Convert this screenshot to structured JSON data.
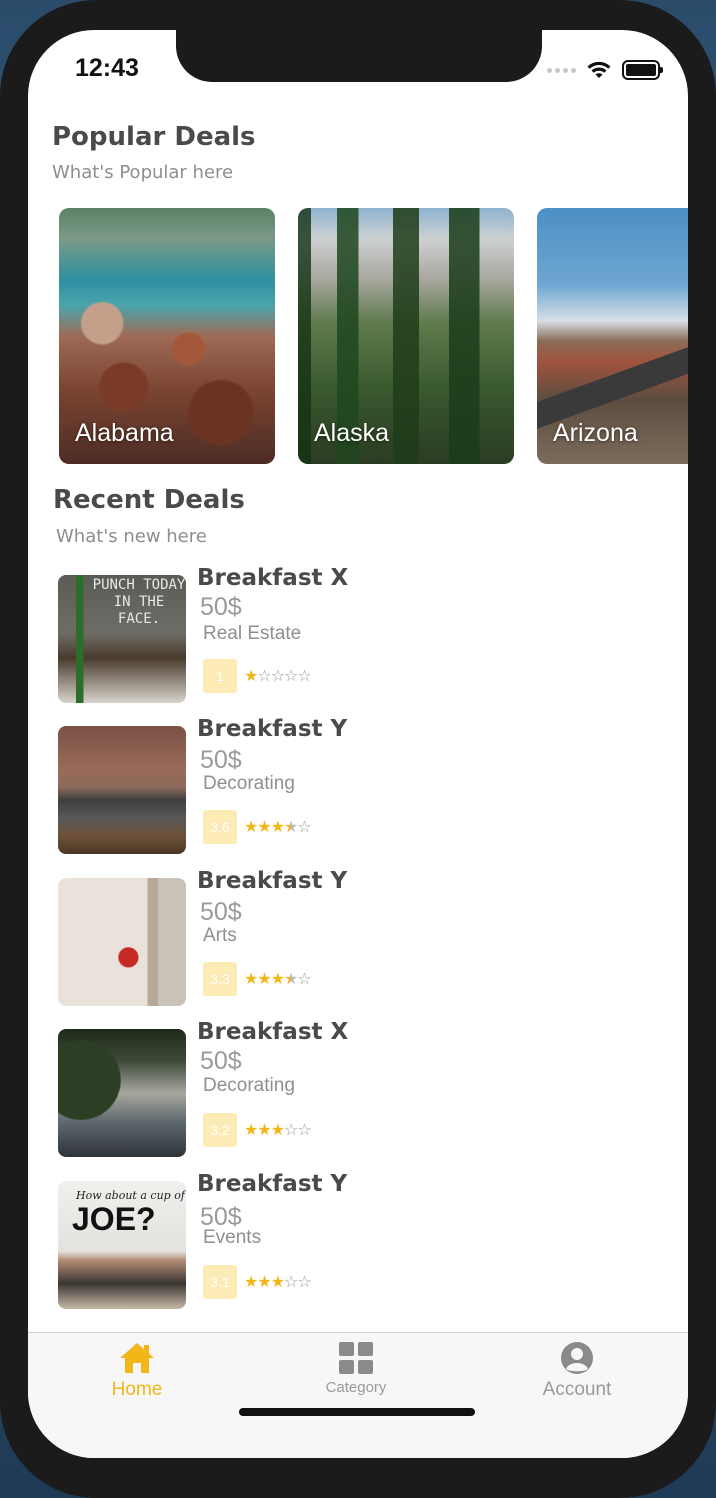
{
  "status_bar": {
    "time": "12:43"
  },
  "popular": {
    "title": "Popular Deals",
    "subtitle": "What's Popular here",
    "cards": [
      {
        "label": "Alabama"
      },
      {
        "label": "Alaska"
      },
      {
        "label": "Arizona"
      }
    ]
  },
  "recent": {
    "title": "Recent Deals",
    "subtitle": "What's new here",
    "items": [
      {
        "name": "Breakfast X",
        "price": "50$",
        "category": "Real Estate",
        "rating": "1",
        "stars": 1,
        "image_text": "PUNCH TODAY IN THE FACE."
      },
      {
        "name": "Breakfast Y",
        "price": "50$",
        "category": "Decorating",
        "rating": "3.6",
        "stars": 3.5
      },
      {
        "name": "Breakfast Y",
        "price": "50$",
        "category": "Arts",
        "rating": "3.3",
        "stars": 3.5
      },
      {
        "name": "Breakfast X",
        "price": "50$",
        "category": "Decorating",
        "rating": "3.2",
        "stars": 3
      },
      {
        "name": "Breakfast Y",
        "price": "50$",
        "category": "Events",
        "rating": "3.1",
        "stars": 3,
        "image_text_small": "How about a cup of",
        "image_text_big": "JOE?"
      }
    ]
  },
  "tabs": [
    {
      "label": "Home",
      "icon": "home-icon",
      "active": true
    },
    {
      "label": "Category",
      "icon": "grid-icon",
      "active": false
    },
    {
      "label": "Account",
      "icon": "account-icon",
      "active": false
    }
  ],
  "colors": {
    "accent": "#f2b619",
    "badge": "#fdebb5",
    "inactive": "#9a9a9a"
  }
}
